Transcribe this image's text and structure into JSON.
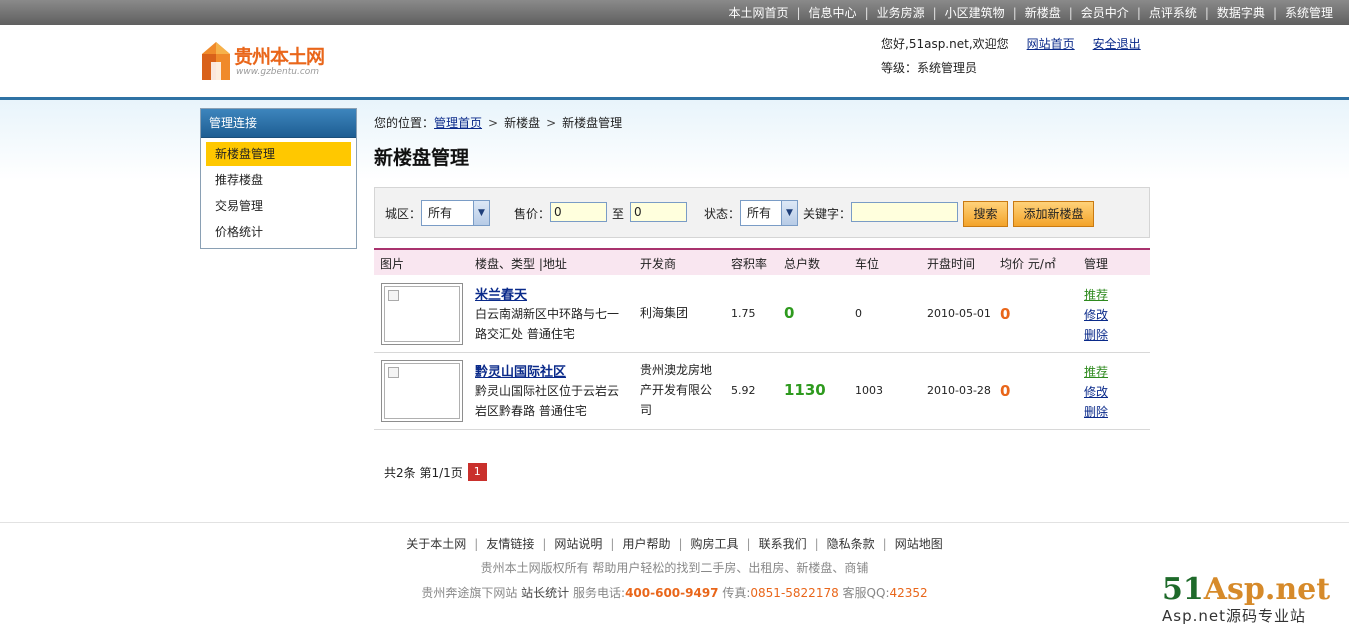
{
  "topnav": {
    "items": [
      "本土网首页",
      "信息中心",
      "业务房源",
      "小区建筑物",
      "新楼盘",
      "会员中介",
      "点评系统",
      "数据字典",
      "系统管理"
    ]
  },
  "logo": {
    "text": "贵州本土网",
    "sub": "www.gzbentu.com"
  },
  "user": {
    "greeting": "您好,51asp.net,欢迎您",
    "home_link": "网站首页",
    "logout_link": "安全退出",
    "level": "等级：系统管理员"
  },
  "sidebar": {
    "title": "管理连接",
    "items": [
      "新楼盘管理",
      "推荐楼盘",
      "交易管理",
      "价格统计"
    ]
  },
  "breadcrumb": {
    "prefix": "您的位置：",
    "home": "管理首页",
    "level2": "新楼盘",
    "level3": "新楼盘管理"
  },
  "page_title": "新楼盘管理",
  "filter": {
    "area_label": "城区：",
    "area_value": "所有",
    "price_label": "售价：",
    "price_from": "0",
    "to_label": "至",
    "price_to": "0",
    "status_label": "状态：",
    "status_value": "所有",
    "keyword_label": "关键字：",
    "keyword_value": "",
    "search_button": "搜索",
    "add_button": "添加新楼盘"
  },
  "table": {
    "headers": [
      "图片",
      "楼盘、类型 |地址",
      "开发商",
      "容积率",
      "总户数",
      "车位",
      "开盘时间",
      "均价  元/㎡",
      "管理"
    ],
    "rows": [
      {
        "name": "米兰春天",
        "address": "白云南湖新区中环路与七一路交汇处 普通住宅",
        "developer": "利海集团",
        "ratio": "1.75",
        "households": "0",
        "parking": "0",
        "open_date": "2010-05-01",
        "avg_price": "0",
        "op_recommend": "推荐",
        "op_edit": "修改",
        "op_delete": "删除"
      },
      {
        "name": "黔灵山国际社区",
        "address": "黔灵山国际社区位于云岩云岩区黔春路 普通住宅",
        "developer": "贵州澳龙房地产开发有限公司",
        "ratio": "5.92",
        "households": "1130",
        "parking": "1003",
        "open_date": "2010-03-28",
        "avg_price": "0",
        "op_recommend": "推荐",
        "op_edit": "修改",
        "op_delete": "删除"
      }
    ]
  },
  "pager": {
    "summary": "共2条 第1/1页",
    "current_page": "1"
  },
  "footer": {
    "links": [
      "关于本土网",
      "友情链接",
      "网站说明",
      "用户帮助",
      "购房工具",
      "联系我们",
      "隐私条款",
      "网站地图"
    ],
    "copyright": "贵州本土网版权所有  帮助用户轻松的找到二手房、出租房、新楼盘、商铺",
    "company": "贵州奔途旗下网站",
    "stats": "站长统计",
    "phone_label": "服务电话:",
    "phone": "400-600-9497",
    "fax_label": "传真:",
    "fax": "0851-5822178",
    "qq_label": "客服QQ:",
    "qq": "42352"
  },
  "watermark": {
    "main_a": "51",
    "main_b": "Asp.net",
    "sub": "Asp.net源码专业站"
  },
  "colors": {
    "accent": "#2f72a4",
    "highlight": "#ffc800",
    "orange": "#e9661a",
    "green": "#2e9a1e"
  }
}
